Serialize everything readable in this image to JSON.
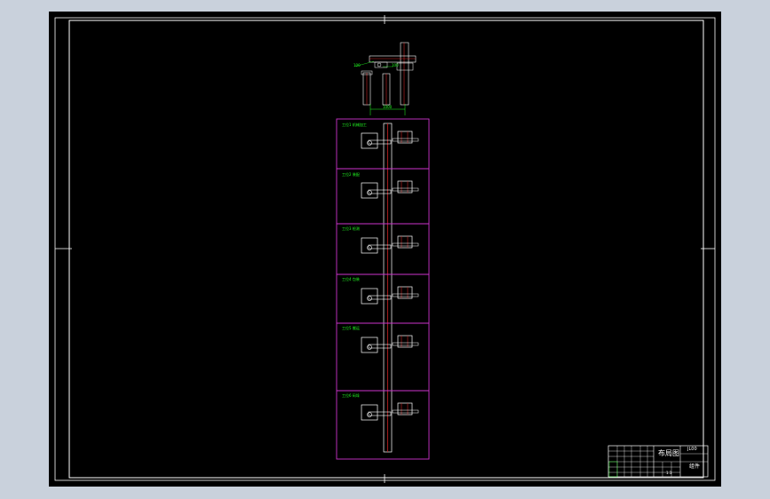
{
  "colors": {
    "background": "#c9d1dc",
    "sheet": "#000000",
    "border": "#ffffff",
    "frame": "#cc33cc",
    "annotation": "#22ff22",
    "section": "#cc2222"
  },
  "top_view": {
    "dimension_text": "1000",
    "callout_left": "100",
    "callout_right": "100"
  },
  "stages": [
    {
      "label": "工位1 机械加工"
    },
    {
      "label": "工位2 装配"
    },
    {
      "label": "工位3 检测"
    },
    {
      "label": "工位4 包装"
    },
    {
      "label": "工位5 搬运"
    },
    {
      "label": "工位6 码垛"
    }
  ],
  "title_block": {
    "drawing_title": "布局图",
    "drawing_number": "JL00",
    "material": "组件",
    "scale": "1:1"
  }
}
